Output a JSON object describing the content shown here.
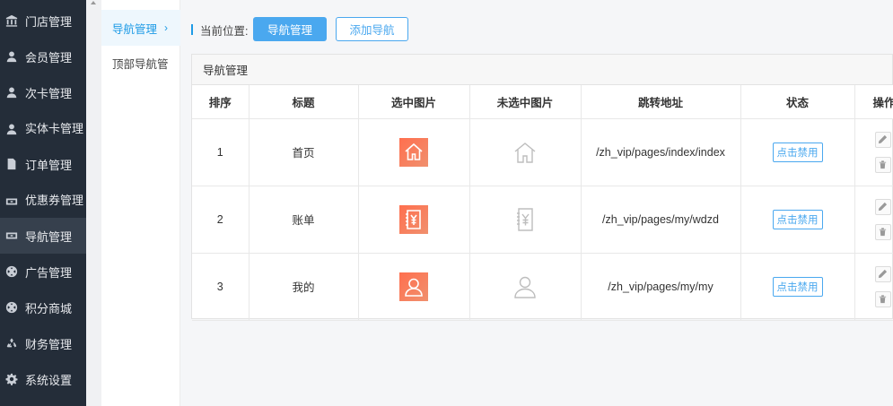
{
  "sidebar": {
    "items": [
      {
        "label": "门店管理",
        "icon": "bank-icon"
      },
      {
        "label": "会员管理",
        "icon": "user-icon"
      },
      {
        "label": "次卡管理",
        "icon": "user-icon"
      },
      {
        "label": "实体卡管理",
        "icon": "user-icon"
      },
      {
        "label": "订单管理",
        "icon": "document-icon"
      },
      {
        "label": "优惠券管理",
        "icon": "ticket-icon"
      },
      {
        "label": "导航管理",
        "icon": "ticket-icon"
      },
      {
        "label": "广告管理",
        "icon": "globe-icon"
      },
      {
        "label": "积分商城",
        "icon": "globe-icon"
      },
      {
        "label": "财务管理",
        "icon": "recycle-icon"
      },
      {
        "label": "系统设置",
        "icon": "gear-icon"
      }
    ]
  },
  "subnav": {
    "items": [
      {
        "label": "导航管理",
        "active": true
      },
      {
        "label": "顶部导航管",
        "active": false
      }
    ]
  },
  "breadcrumb": {
    "label": "当前位置:",
    "current": "导航管理",
    "add_button": "添加导航"
  },
  "panel": {
    "title": "导航管理",
    "columns": [
      "排序",
      "标题",
      "选中图片",
      "未选中图片",
      "跳转地址",
      "状态",
      "操作"
    ],
    "rows": [
      {
        "sort": "1",
        "title": "首页",
        "icon": "home-icon",
        "url": "/zh_vip/pages/index/index",
        "status": "点击禁用"
      },
      {
        "sort": "2",
        "title": "账单",
        "icon": "bill-icon",
        "url": "/zh_vip/pages/my/wdzd",
        "status": "点击禁用"
      },
      {
        "sort": "3",
        "title": "我的",
        "icon": "person-icon",
        "url": "/zh_vip/pages/my/my",
        "status": "点击禁用"
      }
    ]
  },
  "colors": {
    "sidebar_bg": "#242d39",
    "accent": "#4aa8ef",
    "icon_selected": "#ff6f4e"
  }
}
